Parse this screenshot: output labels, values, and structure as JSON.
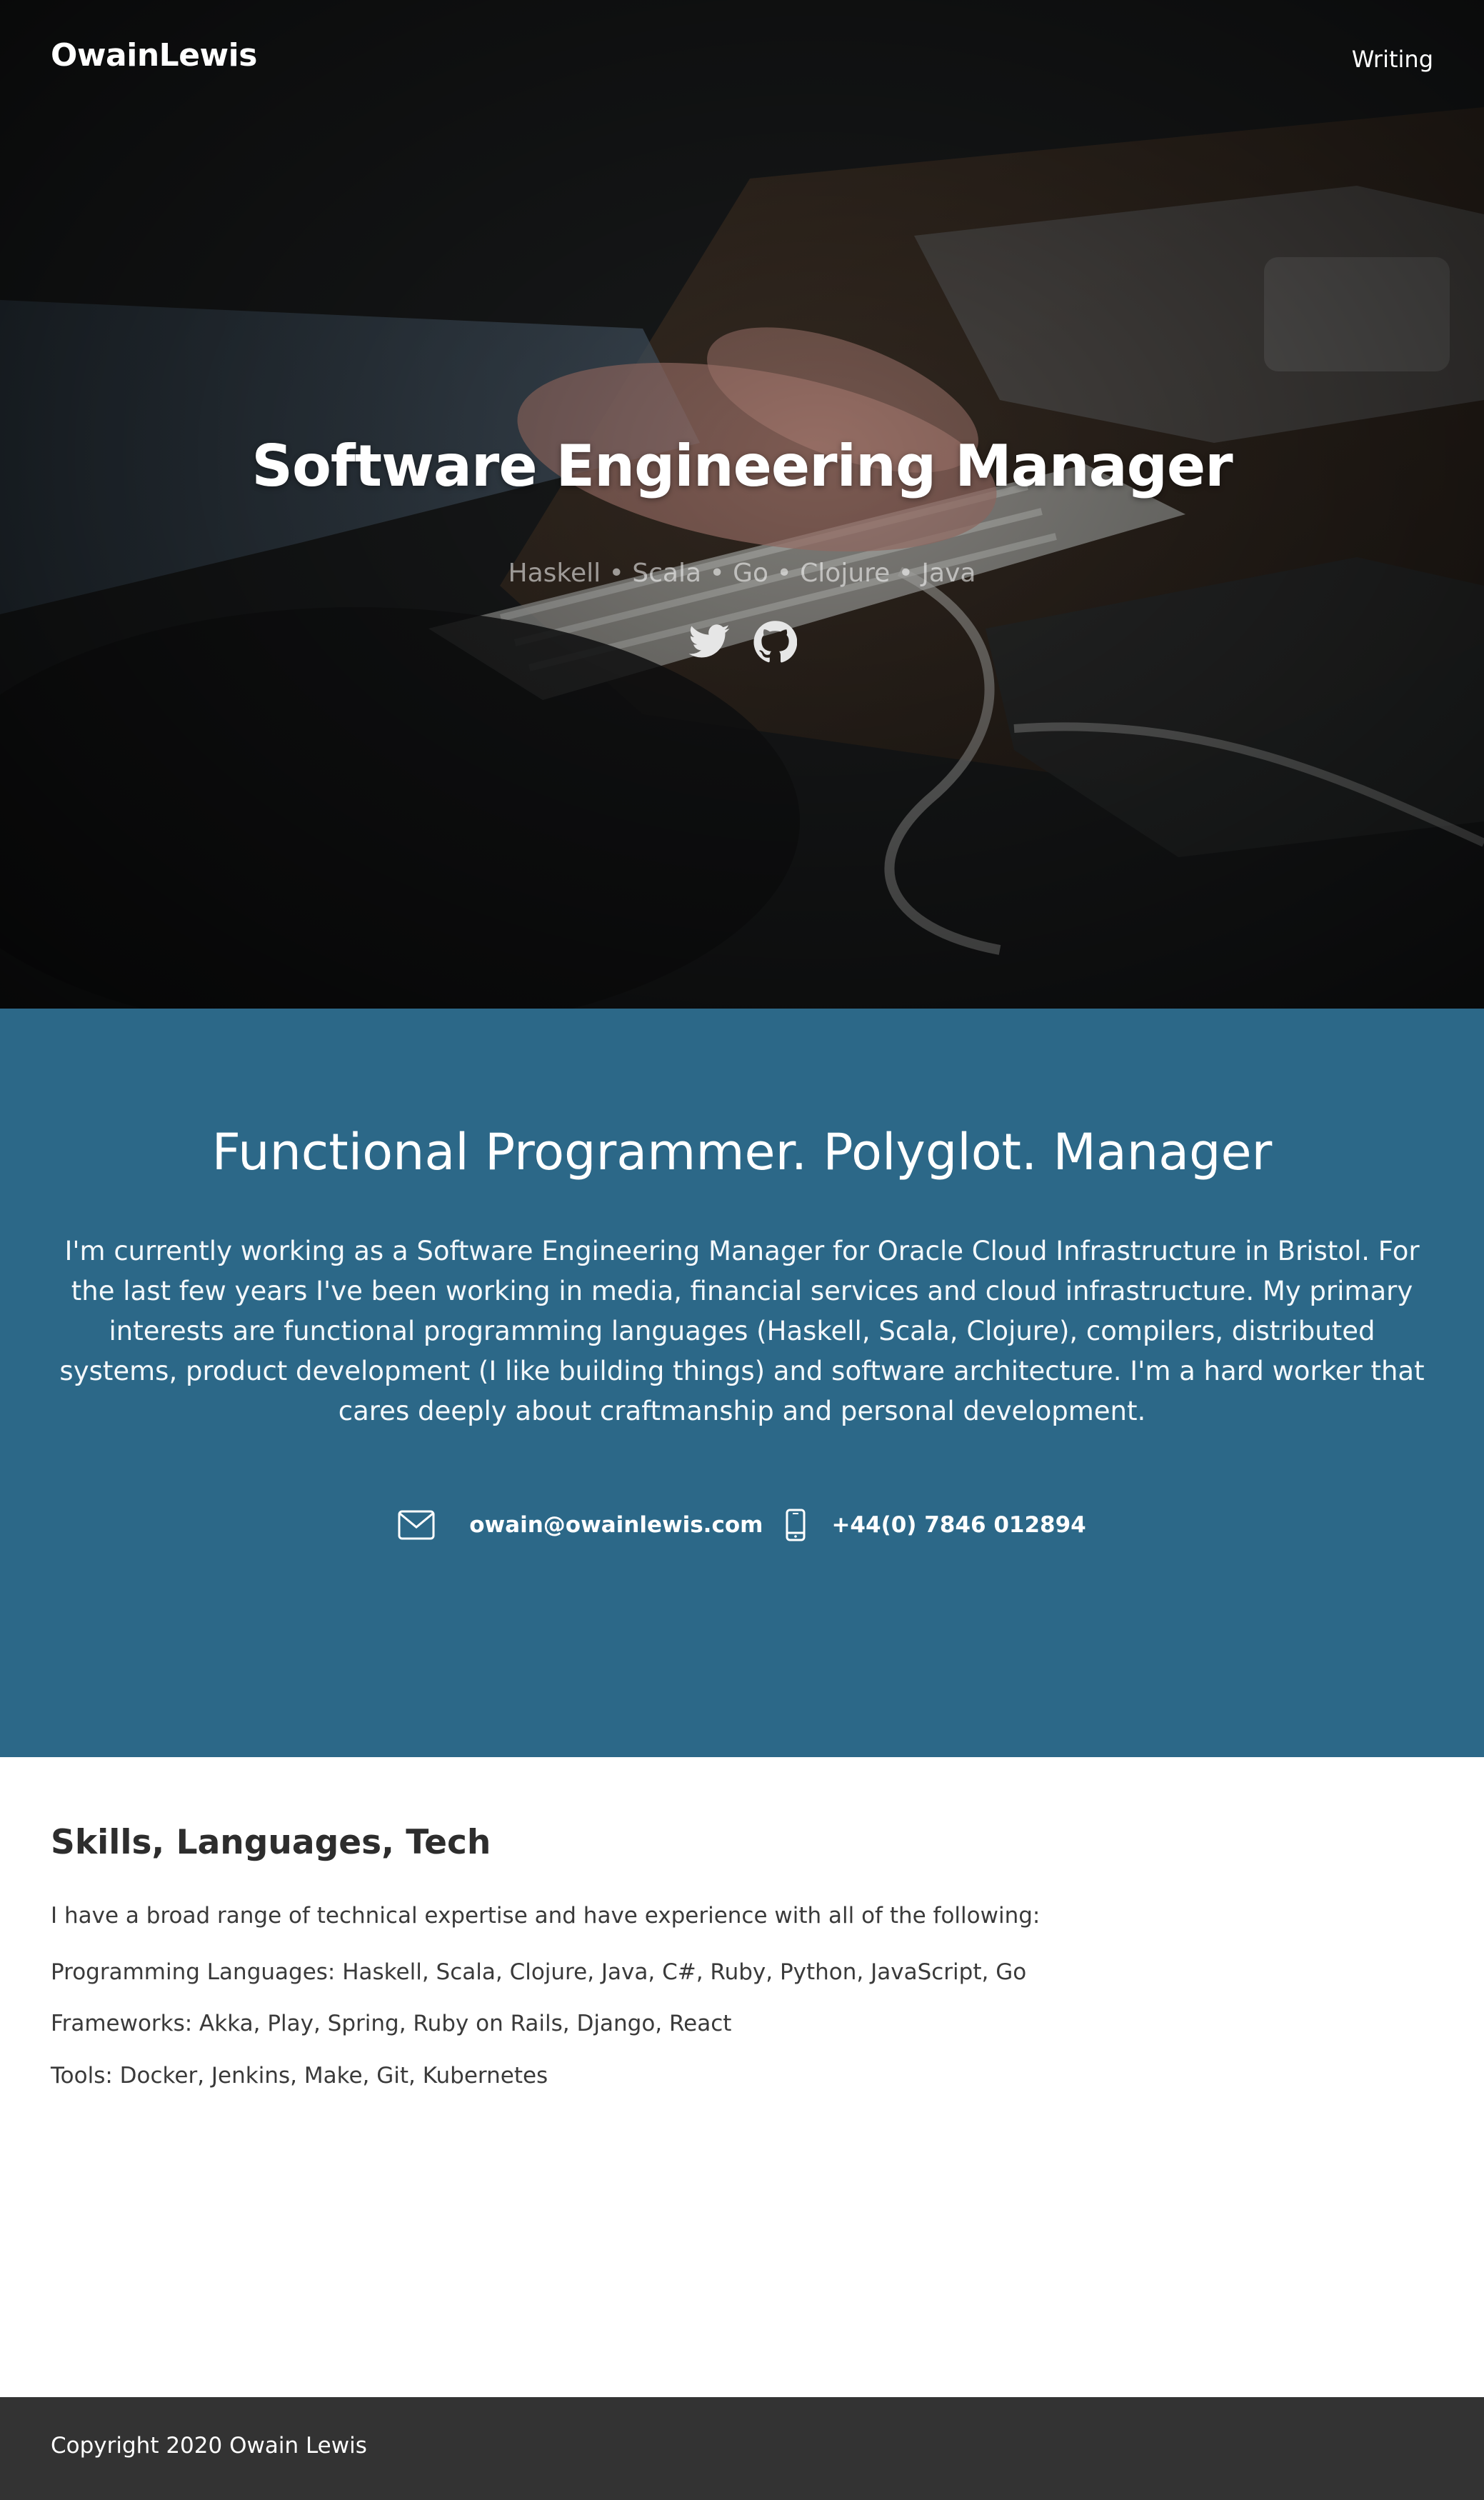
{
  "nav": {
    "brand": "OwainLewis",
    "links": [
      {
        "label": "Writing"
      }
    ]
  },
  "hero": {
    "title": "Software Engineering Manager",
    "subtitle": "Haskell • Scala • Go • Clojure • Java",
    "social": [
      {
        "icon": "twitter-icon"
      },
      {
        "icon": "github-icon"
      }
    ]
  },
  "about": {
    "heading": "Functional Programmer. Polyglot. Manager",
    "body": "I'm currently working as a Software Engineering Manager for Oracle Cloud Infrastructure in Bristol. For the last few years I've been working in media, financial services and cloud infrastructure. My primary interests are functional programming languages (Haskell, Scala, Clojure), compilers, distributed systems, product development (I like building things) and software architecture. I'm a hard worker that cares deeply about craftmanship and personal development.",
    "email": "owain@owainlewis.com",
    "phone": "+44(0) 7846 012894",
    "background_color": "#2c6888"
  },
  "skills": {
    "heading": "Skills, Languages, Tech",
    "intro": "I have a broad range of technical expertise and have experience with all of the following:",
    "languages": "Programming Languages: Haskell, Scala, Clojure, Java, C#, Ruby, Python, JavaScript, Go",
    "frameworks": "Frameworks: Akka, Play, Spring, Ruby on Rails, Django, React",
    "tools": "Tools: Docker, Jenkins, Make, Git, Kubernetes"
  },
  "footer": {
    "copyright": "Copyright 2020 Owain Lewis",
    "background_color": "#333333"
  }
}
